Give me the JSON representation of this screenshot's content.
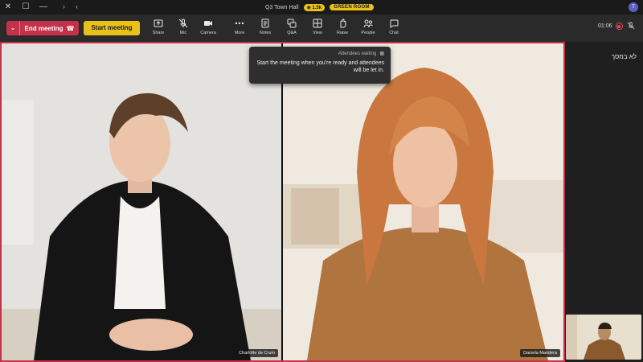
{
  "titlebar": {
    "badge_room": "GREEN ROOM",
    "badge_viewers": "1.5k",
    "meeting_title": "Q3 Town Hall",
    "avatar_initials": "T"
  },
  "toolbar": {
    "end_meeting_label": "End meeting",
    "start_meeting_label": "Start meeting",
    "tools": [
      {
        "label": "Share"
      },
      {
        "label": "Mic"
      },
      {
        "label": "Camera"
      },
      {
        "label": "More"
      },
      {
        "label": "Notes"
      },
      {
        "label": "Q&A"
      },
      {
        "label": "View"
      },
      {
        "label": "Raise"
      },
      {
        "label": "People"
      },
      {
        "label": "Chat"
      }
    ],
    "timer": "01:06"
  },
  "toast": {
    "heading": "Attendees waiting",
    "body": "Start the meeting when you're ready and attendees will be let in."
  },
  "participants": [
    {
      "name": "Charlotte de Crum"
    },
    {
      "name": "Daniela Mandera"
    }
  ],
  "side_panel": {
    "title": "לא במסך"
  },
  "colors": {
    "accent_red": "#c4314b",
    "accent_yellow": "#e8c21a",
    "brand": "#5b5fc7"
  }
}
